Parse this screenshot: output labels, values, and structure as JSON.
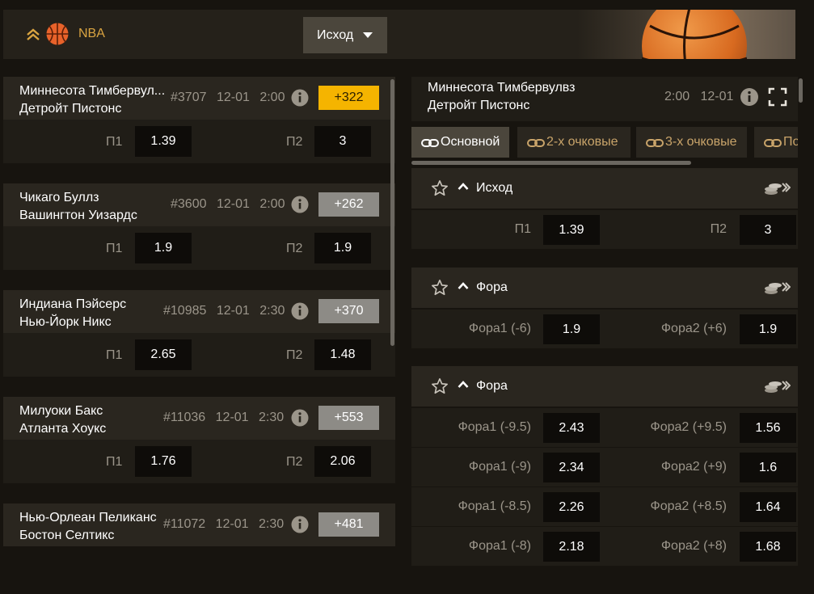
{
  "league": {
    "name": "NBA"
  },
  "market_select": {
    "value": "Исход"
  },
  "matches": [
    {
      "team1": "Миннесота Тимбервул...",
      "team2": "Детройт Пистонс",
      "id": "#3707",
      "date": "12-01",
      "time": "2:00",
      "count": "+322",
      "active": true,
      "o1_label": "П1",
      "o1": "1.39",
      "o2_label": "П2",
      "o2": "3"
    },
    {
      "team1": "Чикаго Буллз",
      "team2": "Вашингтон Уизардс",
      "id": "#3600",
      "date": "12-01",
      "time": "2:00",
      "count": "+262",
      "o1_label": "П1",
      "o1": "1.9",
      "o2_label": "П2",
      "o2": "1.9"
    },
    {
      "team1": "Индиана Пэйсерс",
      "team2": "Нью-Йорк Никс",
      "id": "#10985",
      "date": "12-01",
      "time": "2:30",
      "count": "+370",
      "o1_label": "П1",
      "o1": "2.65",
      "o2_label": "П2",
      "o2": "1.48"
    },
    {
      "team1": "Милуоки Бакс",
      "team2": "Атланта Хоукс",
      "id": "#11036",
      "date": "12-01",
      "time": "2:30",
      "count": "+553",
      "o1_label": "П1",
      "o1": "1.76",
      "o2_label": "П2",
      "o2": "2.06"
    },
    {
      "team1": "Нью-Орлеан Пеликанс",
      "team2": "Бостон Селтикс",
      "id": "#11072",
      "date": "12-01",
      "time": "2:30",
      "count": "+481"
    }
  ],
  "event": {
    "team1": "Миннесота Тимбервулвз",
    "team2": "Детройт Пистонс",
    "time": "2:00",
    "date": "12-01"
  },
  "tabs": [
    "Основной",
    "2-х очковые",
    "3-х очковые",
    "По"
  ],
  "groups": [
    {
      "title": "Исход",
      "rows": [
        {
          "l1": "П1",
          "v1": "1.39",
          "l2": "П2",
          "v2": "3"
        }
      ]
    },
    {
      "title": "Фора",
      "rows": [
        {
          "l1": "Фора1 (-6)",
          "v1": "1.9",
          "l2": "Фора2 (+6)",
          "v2": "1.9"
        }
      ]
    },
    {
      "title": "Фора",
      "rows": [
        {
          "l1": "Фора1 (-9.5)",
          "v1": "2.43",
          "l2": "Фора2 (+9.5)",
          "v2": "1.56"
        },
        {
          "l1": "Фора1 (-9)",
          "v1": "2.34",
          "l2": "Фора2 (+9)",
          "v2": "1.6"
        },
        {
          "l1": "Фора1 (-8.5)",
          "v1": "2.26",
          "l2": "Фора2 (+8.5)",
          "v2": "1.64"
        },
        {
          "l1": "Фора1 (-8)",
          "v1": "2.18",
          "l2": "Фора2 (+8)",
          "v2": "1.68"
        }
      ]
    }
  ],
  "colors": {
    "accent": "#f5b400",
    "league": "#d9a441",
    "tab_text": "#c9a46a",
    "odd_bg": "#0e0c09"
  },
  "icons": [
    "collapse-up-icon",
    "basketball-icon",
    "caret-down-icon",
    "info-icon",
    "fullscreen-icon",
    "link-icon",
    "star-icon",
    "chevron-up-icon",
    "coins-icon"
  ]
}
